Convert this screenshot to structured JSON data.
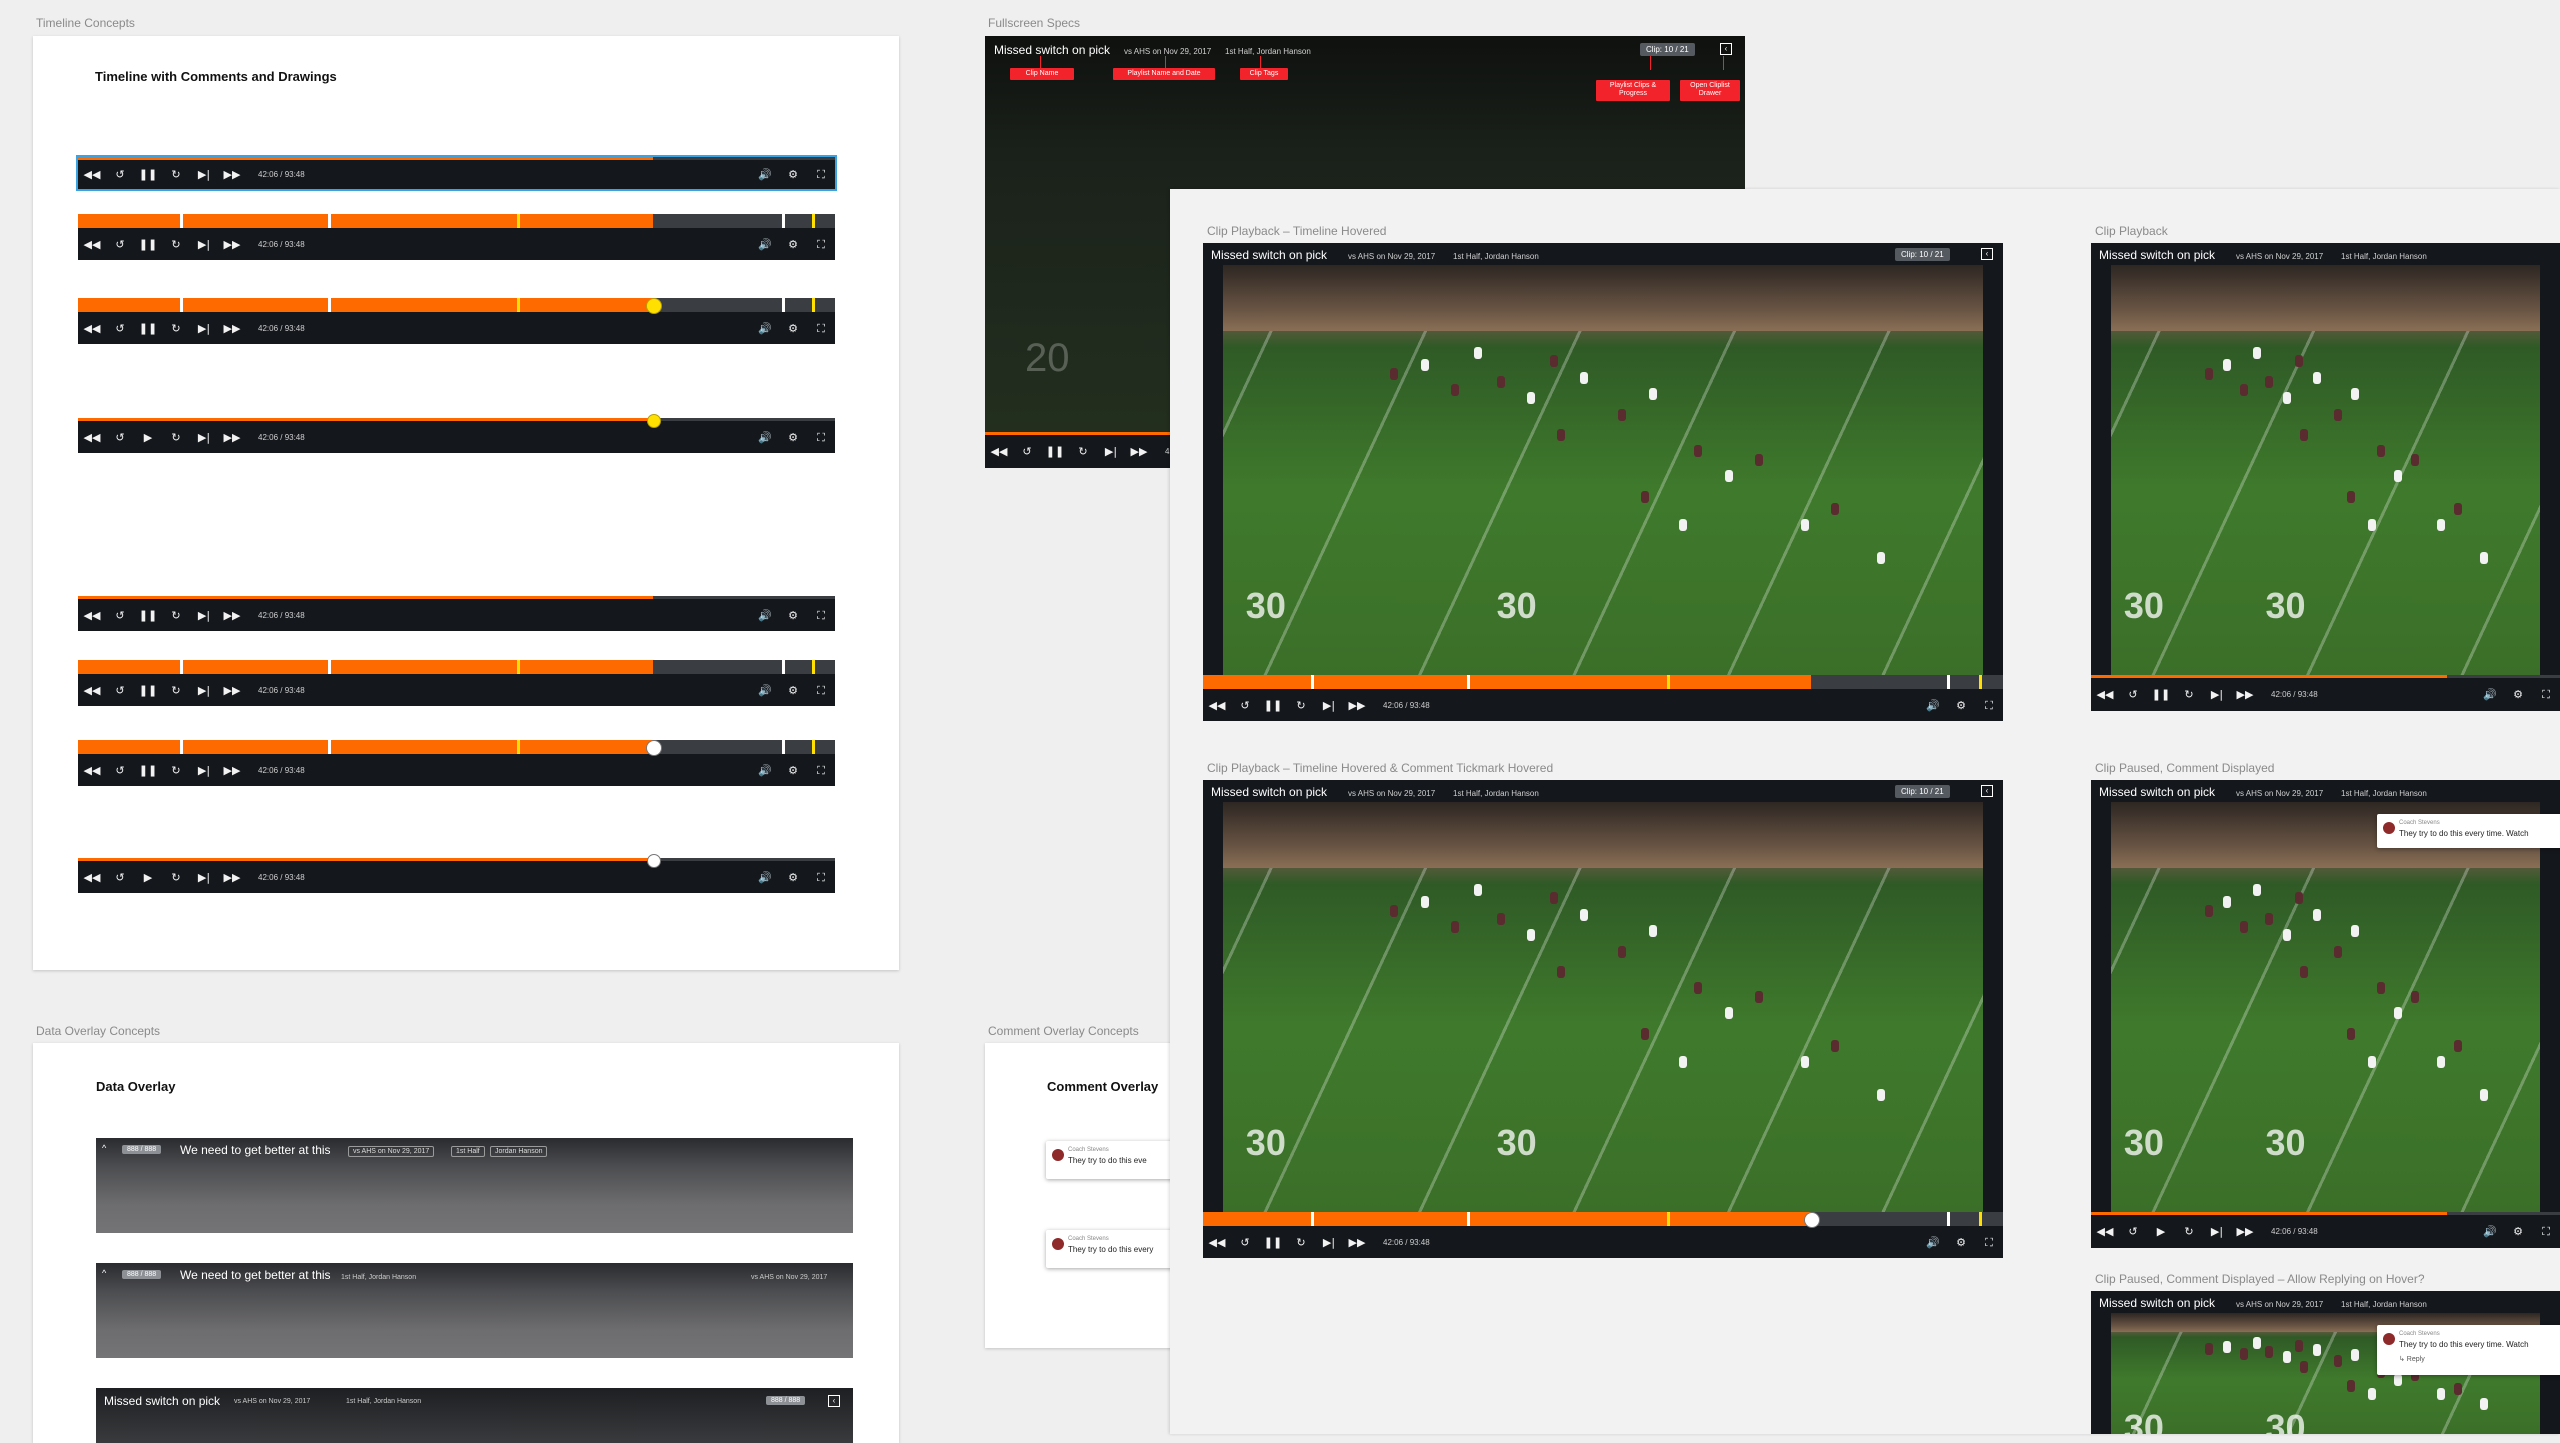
{
  "sections": {
    "timeline_concepts": "Timeline Concepts",
    "fullscreen_specs": "Fullscreen Specs",
    "data_overlay_concepts": "Data Overlay Concepts",
    "comment_overlay_concepts": "Comment Overlay Concepts",
    "clip_playback_timeline_hovered": "Clip Playback – Timeline Hovered",
    "clip_playback": "Clip Playback",
    "clip_playback_comment_tick_hovered": "Clip Playback – Timeline Hovered & Comment Tickmark Hovered",
    "clip_paused_comment": "Clip Paused, Comment Displayed",
    "clip_paused_comment_reply": "Clip Paused, Comment Displayed – Allow Replying on Hover?"
  },
  "artboards": {
    "timeline_title": "Timeline with Comments and Drawings",
    "data_overlay_title": "Data Overlay",
    "comment_overlay_title": "Comment Overlay"
  },
  "player": {
    "time": "42:06 / 93:48",
    "clip_name": "Missed switch on pick",
    "game": "vs AHS on Nov 29, 2017",
    "tags": "1st Half, Jordan Hanson",
    "clip_progress": "10 / 21",
    "clip_label": "Clip:",
    "progress_fraction": 0.76
  },
  "specs": {
    "clip_name": "Clip Name",
    "playlist_name_date": "Playlist Name and Date",
    "clip_tags": "Clip Tags",
    "playlist_clips_progress": "Playlist Clips & Progress",
    "open_clip_drawer": "Open Cliplist Drawer"
  },
  "comment": {
    "author": "Coach Stevens",
    "text": "They try to do this every time. Watch",
    "text_short": "They try to do this every",
    "text_shorter": "They try to do this eve",
    "reply": "↳ Reply"
  },
  "data_overlay": {
    "count": "888 / 888",
    "title": "We need to get better at this",
    "pill_game": "vs AHS on Nov 29, 2017",
    "pill_half": "1st Half",
    "pill_player": "Jordan Hanson",
    "meta_tags": "1st Half, Jordan Hanson",
    "meta_game": "vs AHS on Nov 29, 2017"
  },
  "icons": {
    "rewind": "◀◀",
    "back10": "↺",
    "pause": "❚❚",
    "play": "▶",
    "fwd10": "↻",
    "step": "▶|",
    "ffwd": "▶▶",
    "volume": "🔊",
    "gear": "⚙",
    "fullscreen": "⛶",
    "drawer": "‹",
    "chevron_up": "^"
  },
  "colors": {
    "accent": "#ff6a00",
    "tick_yellow": "#ffe000",
    "spec_red": "#f3232b",
    "player_bg": "#14171c"
  }
}
